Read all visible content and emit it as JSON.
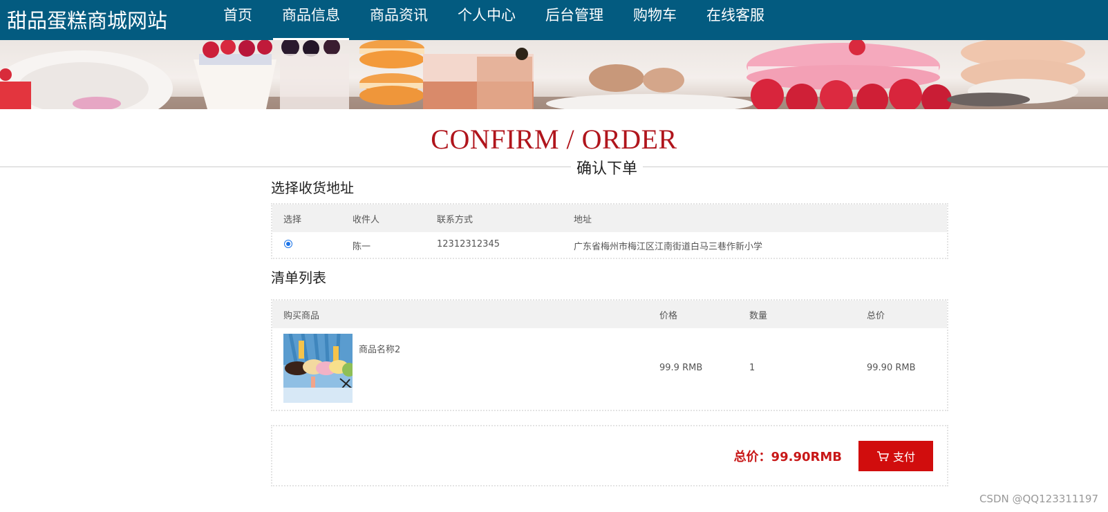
{
  "site": {
    "title": "甜品蛋糕商城网站"
  },
  "nav": {
    "items": [
      {
        "label": "首页"
      },
      {
        "label": "商品信息"
      },
      {
        "label": "商品资讯"
      },
      {
        "label": "个人中心"
      },
      {
        "label": "后台管理"
      },
      {
        "label": "购物车"
      },
      {
        "label": "在线客服"
      }
    ],
    "active_index": 1
  },
  "heading": {
    "en": "CONFIRM / ORDER",
    "cn": "确认下单"
  },
  "address_section": {
    "title": "选择收货地址",
    "columns": [
      "选择",
      "收件人",
      "联系方式",
      "地址"
    ],
    "rows": [
      {
        "selected": true,
        "recipient": "陈一",
        "phone": "12312312345",
        "address": "广东省梅州市梅江区江南街道白马三巷作新小学"
      }
    ]
  },
  "list_section": {
    "title": "清单列表",
    "columns": [
      "购买商品",
      "价格",
      "数量",
      "总价"
    ],
    "items": [
      {
        "name": "商品名称2",
        "price": "99.9 RMB",
        "quantity": "1",
        "subtotal": "99.90 RMB"
      }
    ]
  },
  "payment": {
    "total_label": "总价：99.90RMB",
    "pay_label": "支付",
    "pay_icon": "cart-icon"
  },
  "watermark": "CSDN @QQ123311197",
  "colors": {
    "nav_bg": "#035b80",
    "accent_red": "#b0151c",
    "pay_button": "#d10d0d"
  }
}
